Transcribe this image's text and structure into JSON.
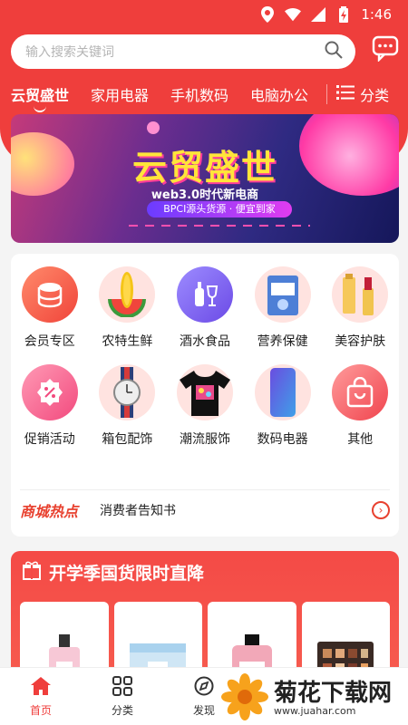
{
  "status_bar": {
    "time": "1:46"
  },
  "search": {
    "placeholder": "输入搜索关键词"
  },
  "tabs": [
    {
      "label": "云贸盛世",
      "active": true
    },
    {
      "label": "家用电器"
    },
    {
      "label": "手机数码"
    },
    {
      "label": "电脑办公"
    }
  ],
  "category_button": {
    "label": "分类"
  },
  "banner": {
    "title": "云贸盛世",
    "subtitle": "web3.0时代新电商",
    "strip": "BPCI源头货源 · 便宜到家"
  },
  "categories": [
    {
      "label": "会员专区",
      "icon": "member-coin-icon"
    },
    {
      "label": "农特生鲜",
      "icon": "corn-watermelon-icon"
    },
    {
      "label": "酒水食品",
      "icon": "wine-icon"
    },
    {
      "label": "营养保健",
      "icon": "health-box-icon"
    },
    {
      "label": "美容护肤",
      "icon": "cosmetics-icon"
    },
    {
      "label": "促销活动",
      "icon": "discount-icon"
    },
    {
      "label": "箱包配饰",
      "icon": "watch-icon"
    },
    {
      "label": "潮流服饰",
      "icon": "tshirt-icon"
    },
    {
      "label": "数码电器",
      "icon": "phone-icon"
    },
    {
      "label": "其他",
      "icon": "bag-icon"
    }
  ],
  "notice": {
    "tag": "商城热点",
    "text": "消费者告知书"
  },
  "promo": {
    "title": "开学季国货限时直降"
  },
  "bottom_nav": [
    {
      "label": "首页",
      "active": true
    },
    {
      "label": "分类"
    },
    {
      "label": "发现"
    }
  ],
  "watermark": {
    "name": "菊花下载网",
    "url": "www.juahar.com"
  },
  "colors": {
    "accent": "#ef3e3c",
    "banner_title": "#ffe53a"
  }
}
